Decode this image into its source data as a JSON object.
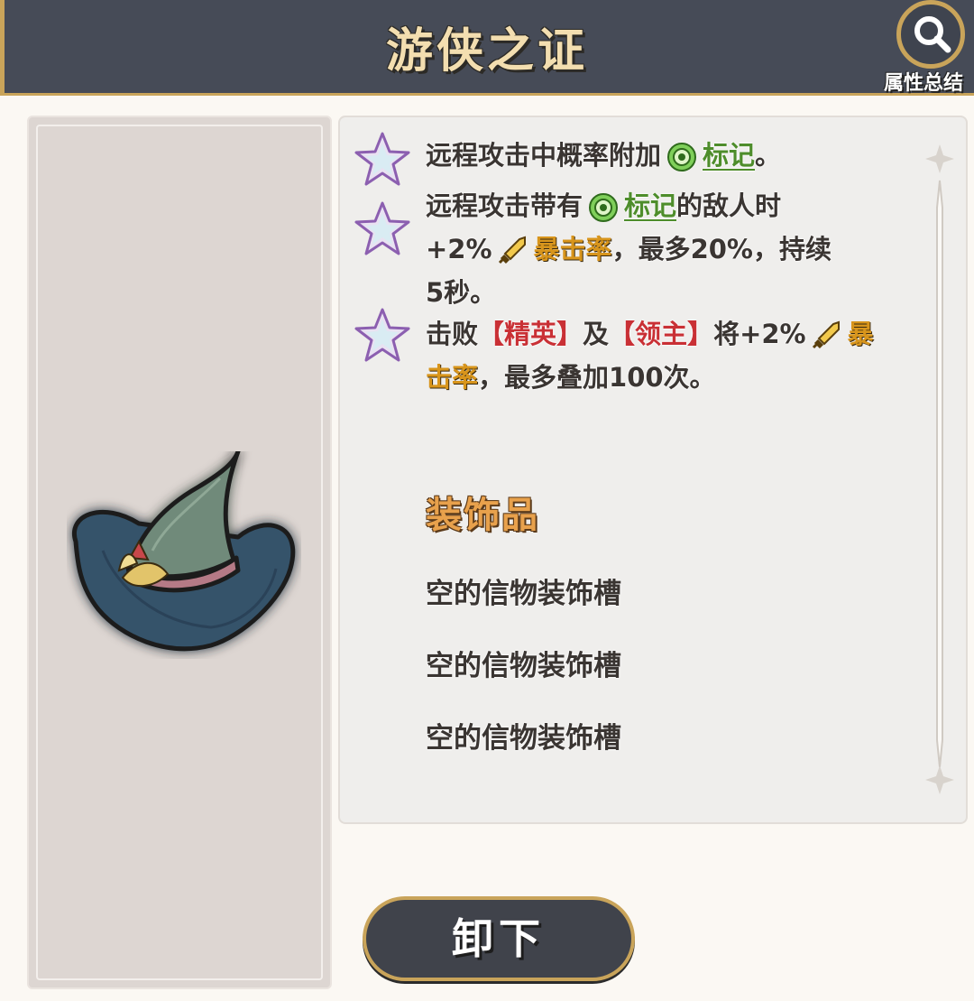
{
  "header": {
    "title": "游侠之证",
    "summary_label": "属性总结"
  },
  "effects": [
    {
      "parts": [
        "远程攻击中概率附加",
        "标记",
        "。"
      ]
    },
    {
      "parts": [
        "远程攻击带有",
        "标记",
        "的敌人时",
        "+2%",
        "暴击率",
        "，最多20%，持续",
        "5秒。"
      ]
    },
    {
      "parts": [
        "击败",
        "【精英】",
        "及",
        "【领主】",
        "将+2%",
        "暴",
        "击率",
        "，最多叠加100次。"
      ]
    }
  ],
  "accessory": {
    "title": "装饰品",
    "slots": [
      "空的信物装饰槽",
      "空的信物装饰槽",
      "空的信物装饰槽"
    ]
  },
  "buttons": {
    "unequip": "卸下"
  },
  "colors": {
    "header_bg": "#464b57",
    "gold_border": "#c9a45a",
    "keyword_green": "#4e8d2b",
    "keyword_orange": "#d8951c",
    "keyword_red": "#c93035"
  }
}
